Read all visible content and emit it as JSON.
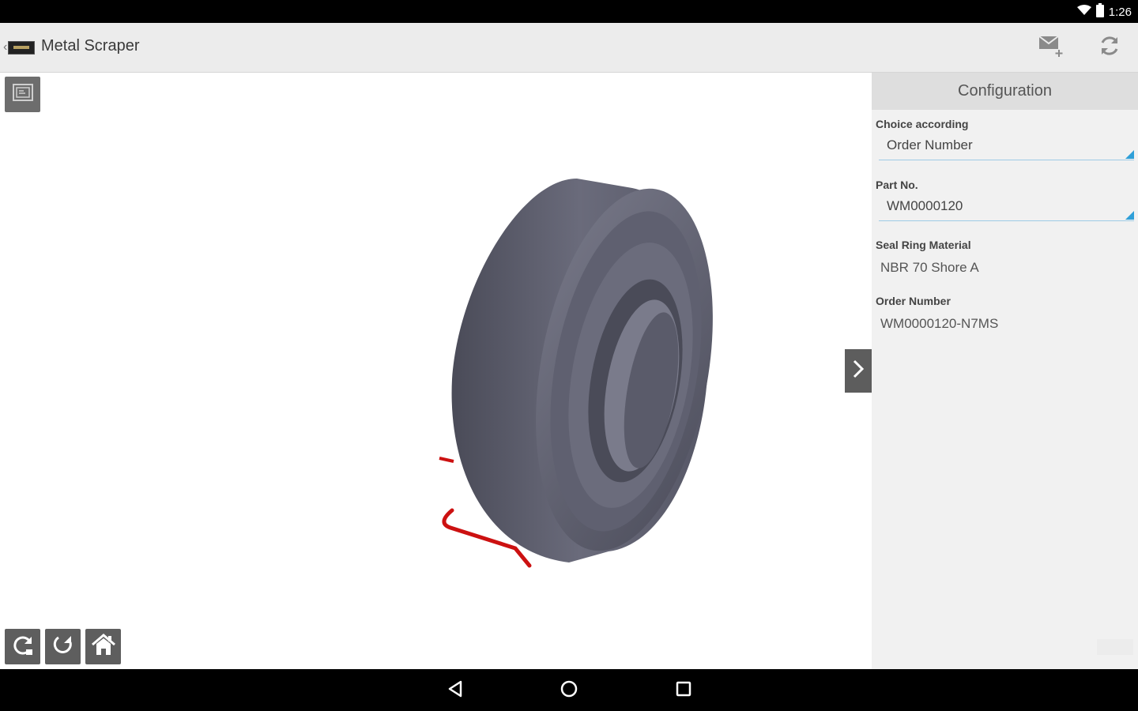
{
  "status": {
    "time": "1:26"
  },
  "appbar": {
    "title": "Metal Scraper"
  },
  "config": {
    "header": "Configuration",
    "choice_label": "Choice according",
    "choice_value": "Order Number",
    "part_label": "Part No.",
    "part_value": "WM0000120",
    "material_label": "Seal Ring Material",
    "material_value": "NBR 70 Shore A",
    "order_label": "Order Number",
    "order_value": "WM0000120-N7MS"
  },
  "colors": {
    "accent": "#2f9fd8",
    "model_body": "#5b5c6b",
    "model_wire": "#cc1111"
  },
  "icons": [
    "wifi-icon",
    "battery-icon",
    "back-chevron-icon",
    "app-logo",
    "share-icon",
    "refresh-icon",
    "view-toggle-icon",
    "rotate-icon",
    "reset-rotate-icon",
    "home-icon",
    "chevron-right-icon",
    "nav-back-icon",
    "nav-home-icon",
    "nav-recents-icon"
  ]
}
